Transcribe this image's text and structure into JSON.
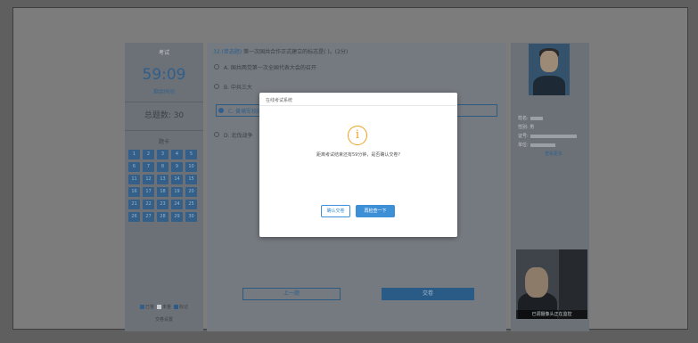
{
  "left_panel": {
    "label_top": "考试",
    "timer": "59:09",
    "timer_sub": "剩余时间",
    "score": "总题数: 30",
    "grid_title": "题卡",
    "cells": [
      "1",
      "2",
      "3",
      "4",
      "5",
      "6",
      "7",
      "8",
      "9",
      "10",
      "11",
      "12",
      "13",
      "14",
      "15",
      "16",
      "17",
      "18",
      "19",
      "20",
      "21",
      "22",
      "23",
      "24",
      "25",
      "26",
      "27",
      "28",
      "29",
      "30"
    ],
    "legend": [
      "已答",
      "未答",
      "标记"
    ],
    "footer": "交卷设置"
  },
  "question": {
    "tag": "32.(单选题)",
    "text": "第一次国共合作正式建立的标志是( )。(2分)",
    "options": [
      "A. 国共两党第一次全国代表大会的召开",
      "B. 中共三大",
      "C. 黄埔军校的创办",
      "D. 北伐战争"
    ],
    "selected_index": 2,
    "prev_label": "上一题",
    "submit_label": "交卷"
  },
  "right_panel": {
    "info": [
      "姓名:",
      "性别: 男",
      "证号:",
      "单位:"
    ],
    "info_link": "查看更多",
    "camera_caption": "已调摄像头正在监控"
  },
  "modal": {
    "title": "在线考试系统",
    "icon": "exclamation-icon",
    "message": "距离考试结束还有59分钟，是否确认交卷?",
    "confirm_label": "确认交卷",
    "check_label": "再检查一下"
  }
}
